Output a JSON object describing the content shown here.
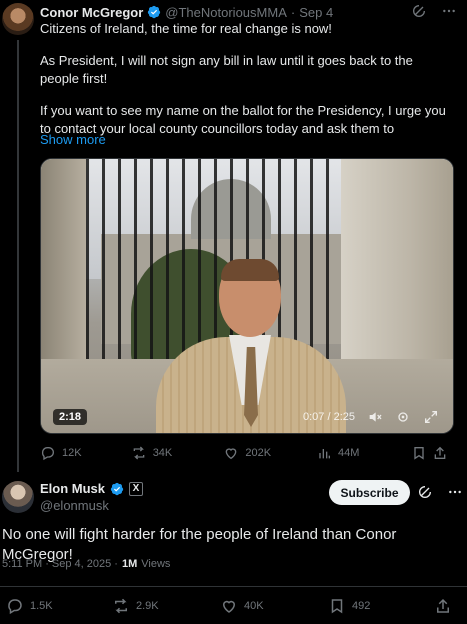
{
  "quoted": {
    "name": "Conor McGregor",
    "handle": "@TheNotoriousMMA",
    "separator": "·",
    "date": "Sep 4",
    "paragraphs": [
      "Citizens of Ireland, the time for real change is now!",
      "As President, I will not sign any bill in law until it goes back to the people first!",
      "If you want to see my name on the ballot for the Presidency, I urge you to contact your local county councillors today and ask them to"
    ],
    "show_more": "Show more",
    "video": {
      "time": "2:18",
      "progress_time": "0:07 / 2:25"
    },
    "actions": {
      "replies": "12K",
      "reposts": "34K",
      "likes": "202K",
      "views": "44M"
    }
  },
  "main": {
    "name": "Elon Musk",
    "badge": "X",
    "handle": "@elonmusk",
    "subscribe_label": "Subscribe",
    "text": "No one will fight harder for the people of Ireland than Conor McGregor!",
    "time": "5:11 PM · Sep 4, 2025 ·",
    "views_num": "1M",
    "views_label": "Views",
    "actions": {
      "replies": "1.5K",
      "reposts": "2.9K",
      "likes": "40K",
      "bookmarks": "492"
    }
  },
  "colors": {
    "accent": "#1d9bf0",
    "muted": "#71767b",
    "text": "#e7e9ea",
    "background": "#000000"
  }
}
